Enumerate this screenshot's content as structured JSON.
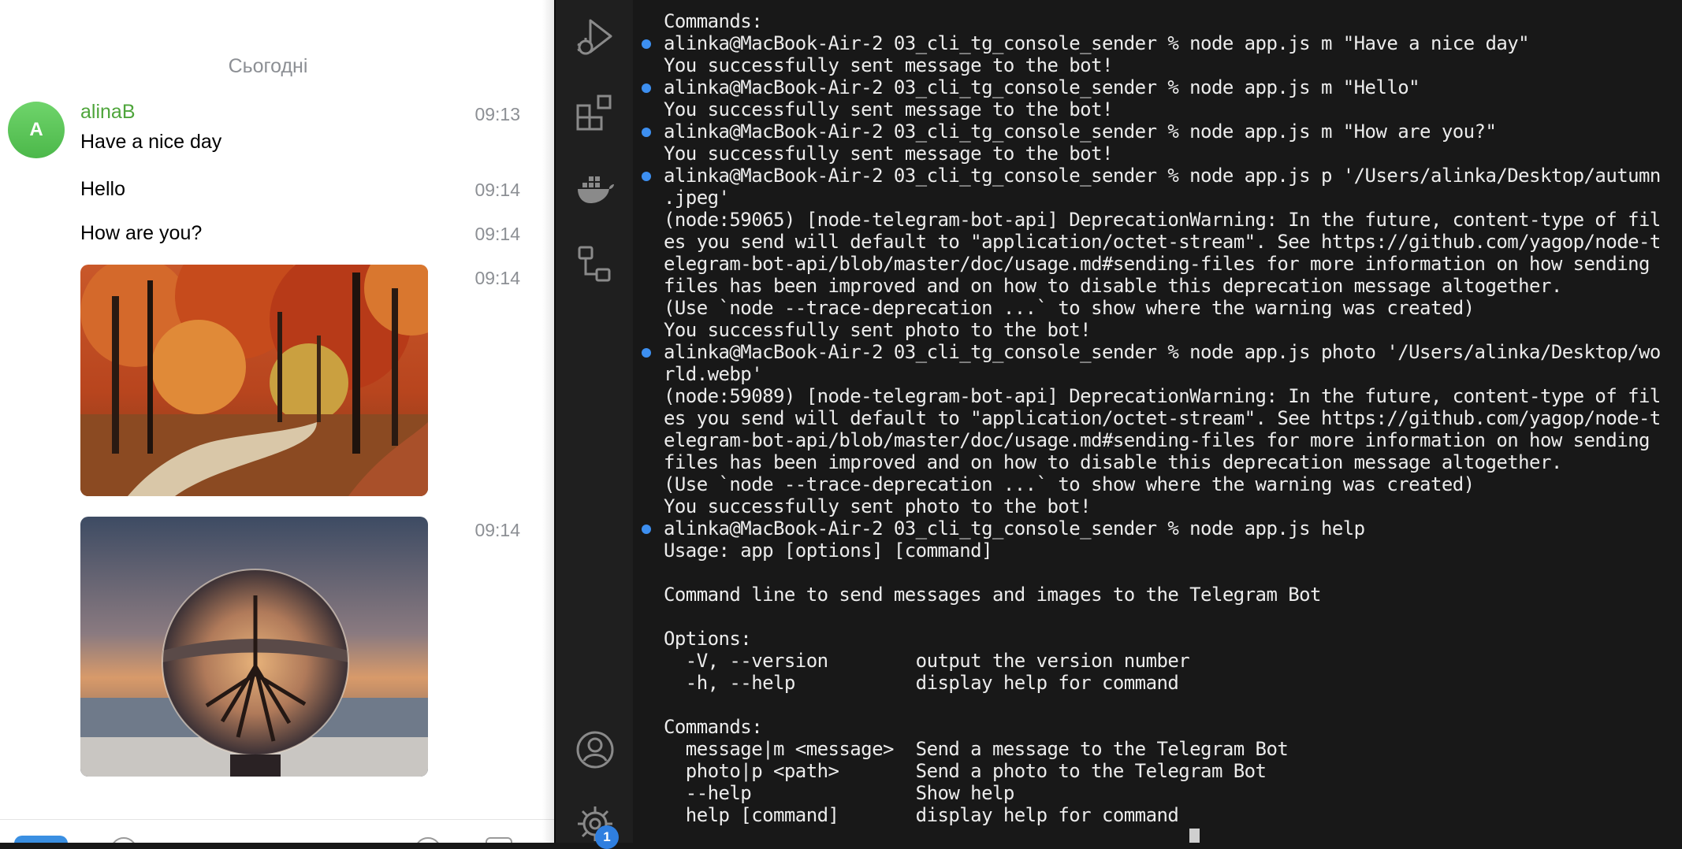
{
  "chat": {
    "date_separator": "Сьогодні",
    "avatar_letter": "A",
    "sender": "alinaB",
    "messages": [
      {
        "text": "Have a nice day",
        "time": "09:13"
      },
      {
        "text": "Hello",
        "time": "09:14"
      },
      {
        "text": "How are you?",
        "time": "09:14"
      }
    ],
    "photos": [
      {
        "subject": "autumn forest path",
        "time": "09:14"
      },
      {
        "subject": "crystal ball with inverted tree",
        "time": "09:14"
      }
    ]
  },
  "activity_bar": {
    "icons": [
      "run-debug-icon",
      "extensions-icon",
      "docker-icon",
      "remote-explorer-icon",
      "account-icon",
      "manage-gear-icon"
    ],
    "settings_badge": "1"
  },
  "terminal": {
    "lines": [
      {
        "text": "Commands:",
        "cmd": false
      },
      {
        "text": "alinka@MacBook-Air-2 03_cli_tg_console_sender % node app.js m \"Have a nice day\"",
        "cmd": true
      },
      {
        "text": "You successfully sent message to the bot!",
        "cmd": false
      },
      {
        "text": "alinka@MacBook-Air-2 03_cli_tg_console_sender % node app.js m \"Hello\"",
        "cmd": true
      },
      {
        "text": "You successfully sent message to the bot!",
        "cmd": false
      },
      {
        "text": "alinka@MacBook-Air-2 03_cli_tg_console_sender % node app.js m \"How are you?\"",
        "cmd": true
      },
      {
        "text": "You successfully sent message to the bot!",
        "cmd": false
      },
      {
        "text": "alinka@MacBook-Air-2 03_cli_tg_console_sender % node app.js p '/Users/alinka/Desktop/autumn",
        "cmd": true
      },
      {
        "text": ".jpeg'",
        "cmd": false
      },
      {
        "text": "(node:59065) [node-telegram-bot-api] DeprecationWarning: In the future, content-type of fil",
        "cmd": false
      },
      {
        "text": "es you send will default to \"application/octet-stream\". See https://github.com/yagop/node-t",
        "cmd": false
      },
      {
        "text": "elegram-bot-api/blob/master/doc/usage.md#sending-files for more information on how sending",
        "cmd": false
      },
      {
        "text": "files has been improved and on how to disable this deprecation message altogether.",
        "cmd": false
      },
      {
        "text": "(Use `node --trace-deprecation ...` to show where the warning was created)",
        "cmd": false
      },
      {
        "text": "You successfully sent photo to the bot!",
        "cmd": false
      },
      {
        "text": "alinka@MacBook-Air-2 03_cli_tg_console_sender % node app.js photo '/Users/alinka/Desktop/wo",
        "cmd": true
      },
      {
        "text": "rld.webp'",
        "cmd": false
      },
      {
        "text": "(node:59089) [node-telegram-bot-api] DeprecationWarning: In the future, content-type of fil",
        "cmd": false
      },
      {
        "text": "es you send will default to \"application/octet-stream\". See https://github.com/yagop/node-t",
        "cmd": false
      },
      {
        "text": "elegram-bot-api/blob/master/doc/usage.md#sending-files for more information on how sending",
        "cmd": false
      },
      {
        "text": "files has been improved and on how to disable this deprecation message altogether.",
        "cmd": false
      },
      {
        "text": "(Use `node --trace-deprecation ...` to show where the warning was created)",
        "cmd": false
      },
      {
        "text": "You successfully sent photo to the bot!",
        "cmd": false
      },
      {
        "text": "alinka@MacBook-Air-2 03_cli_tg_console_sender % node app.js help",
        "cmd": true
      },
      {
        "text": "Usage: app [options] [command]",
        "cmd": false
      },
      {
        "text": "",
        "cmd": false
      },
      {
        "text": "Command line to send messages and images to the Telegram Bot",
        "cmd": false
      },
      {
        "text": "",
        "cmd": false
      },
      {
        "text": "Options:",
        "cmd": false
      },
      {
        "text": "  -V, --version        output the version number",
        "cmd": false
      },
      {
        "text": "  -h, --help           display help for command",
        "cmd": false
      },
      {
        "text": "",
        "cmd": false
      },
      {
        "text": "Commands:",
        "cmd": false
      },
      {
        "text": "  message|m <message>  Send a message to the Telegram Bot",
        "cmd": false
      },
      {
        "text": "  photo|p <path>       Send a photo to the Telegram Bot",
        "cmd": false
      },
      {
        "text": "  --help               Show help",
        "cmd": false
      },
      {
        "text": "  help [command]       display help for command",
        "cmd": false
      }
    ]
  },
  "colors": {
    "sender_name": "#4ea53b",
    "avatar": "#5cc85a",
    "prompt_dot": "#3d8ff0",
    "terminal_bg": "#181818",
    "badge": "#2f7fe0"
  }
}
